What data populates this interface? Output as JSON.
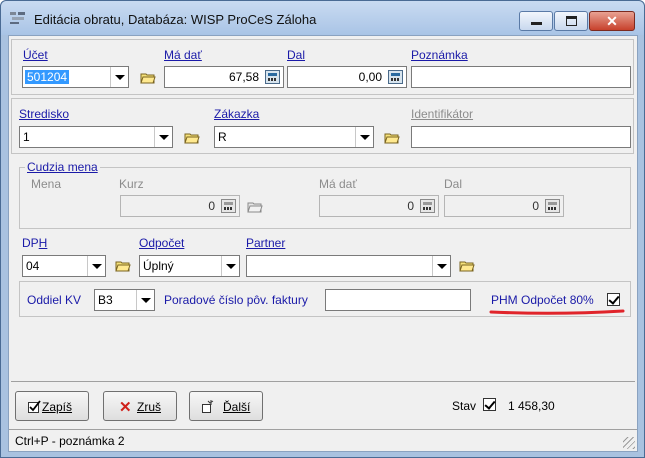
{
  "window": {
    "title": "Editácia obratu,  Databáza: WISP ProCeS Záloha",
    "close_glyph": "✕"
  },
  "account": {
    "ucet": {
      "label": "Účet",
      "value": "501204"
    },
    "ma_dat": {
      "label": "Má dať",
      "value": "67,58"
    },
    "dal": {
      "label": "Dal",
      "value": "0,00"
    },
    "poznamka": {
      "label": "Poznámka",
      "value": ""
    }
  },
  "center": {
    "stredisko": {
      "label": "Stredisko",
      "value": "1"
    },
    "zakazka": {
      "label": "Zákazka",
      "value": "R"
    },
    "identifikator": {
      "label": "Identifikátor",
      "value": ""
    }
  },
  "foreign": {
    "group_label": "Cudzia mena",
    "mena": {
      "label": "Mena"
    },
    "kurz": {
      "label": "Kurz",
      "value": "0"
    },
    "ma_dat": {
      "label": "Má dať",
      "value": "0"
    },
    "dal": {
      "label": "Dal",
      "value": "0"
    }
  },
  "tax": {
    "dph": {
      "label": "DPH",
      "value": "04"
    },
    "odpocet": {
      "label": "Odpočet",
      "value": "Úplný"
    },
    "partner": {
      "label": "Partner",
      "value": ""
    }
  },
  "kv": {
    "oddiel": {
      "label": "Oddiel KV",
      "value": "B3"
    },
    "poradove": {
      "label": "Poradové číslo pôv. faktury",
      "value": ""
    },
    "phm": {
      "label": "PHM Odpočet 80%",
      "checked": true
    },
    "annotation_color": "#e0242a"
  },
  "actions": {
    "save": "Zapíš",
    "cancel": "Zruš",
    "next": "Ďalší",
    "stav_label": "Stav",
    "stav_checked": true,
    "total": "1 458,30"
  },
  "status": {
    "text": "Ctrl+P - poznámka 2"
  },
  "icons": [
    "app-icon",
    "folder-icon",
    "calculator-icon",
    "dropdown-arrow-icon",
    "checkbox-icon",
    "cancel-x-icon",
    "next-icon",
    "resize-grip-icon"
  ]
}
